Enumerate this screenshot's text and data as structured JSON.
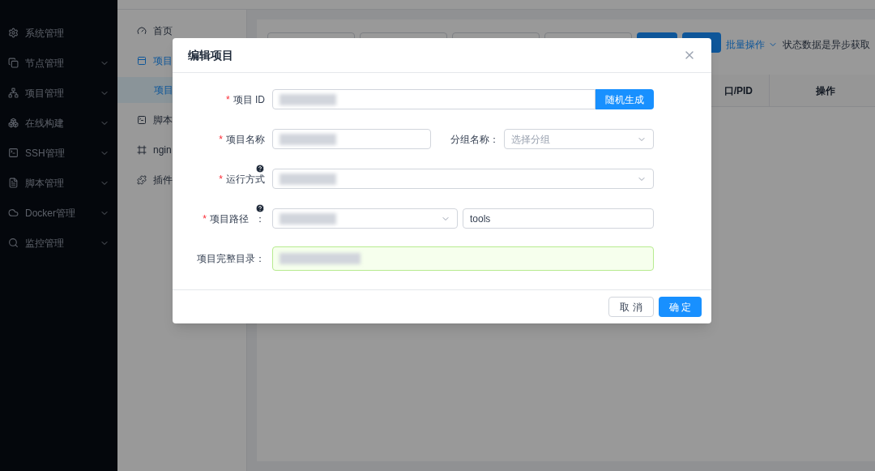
{
  "sidebar": {
    "items": [
      {
        "label": "系统管理",
        "expandable": false
      },
      {
        "label": "节点管理",
        "expandable": true
      },
      {
        "label": "项目管理",
        "expandable": true
      },
      {
        "label": "在线构建",
        "expandable": true
      },
      {
        "label": "SSH管理",
        "expandable": true
      },
      {
        "label": "脚本管理",
        "expandable": true
      },
      {
        "label": "Docker管理",
        "expandable": true
      },
      {
        "label": "监控管理",
        "expandable": true
      }
    ]
  },
  "submenu": {
    "items": [
      {
        "label": "首页",
        "selected": false
      },
      {
        "label": "项目",
        "selected": true,
        "children": [
          {
            "label": "项目",
            "selected": true
          }
        ]
      },
      {
        "label": "脚本",
        "selected": false
      },
      {
        "label": "ngin",
        "selected": false
      },
      {
        "label": "插件",
        "selected": false
      }
    ]
  },
  "toolbar": {
    "batch": "批量操作",
    "note": "状态数据是异步获取"
  },
  "table": {
    "columns": [
      "口/PID",
      "操作"
    ]
  },
  "dialog": {
    "title": "编辑项目",
    "fields": [
      {
        "kind": "input-button",
        "label": "项目 ID",
        "required_mark": "*",
        "blurred": true,
        "button": "随机生成"
      },
      {
        "kind": "input-select",
        "label": "项目名称",
        "required_mark": "*",
        "blurred": true,
        "second_label": "分组名称：",
        "placeholder": "选择分组"
      },
      {
        "kind": "select",
        "label": "运行方式",
        "required_mark": "*",
        "help": true,
        "blurred": true
      },
      {
        "kind": "select-input",
        "label": "项目路径",
        "required_mark": "*",
        "help": true,
        "suffix": "：",
        "blurred": true,
        "value": "tools"
      },
      {
        "kind": "success-input",
        "label": "项目完整目录：",
        "blurred": true
      }
    ],
    "buttons": [
      {
        "label": "取 消",
        "primary": false
      },
      {
        "label": "确 定",
        "primary": true
      }
    ]
  }
}
